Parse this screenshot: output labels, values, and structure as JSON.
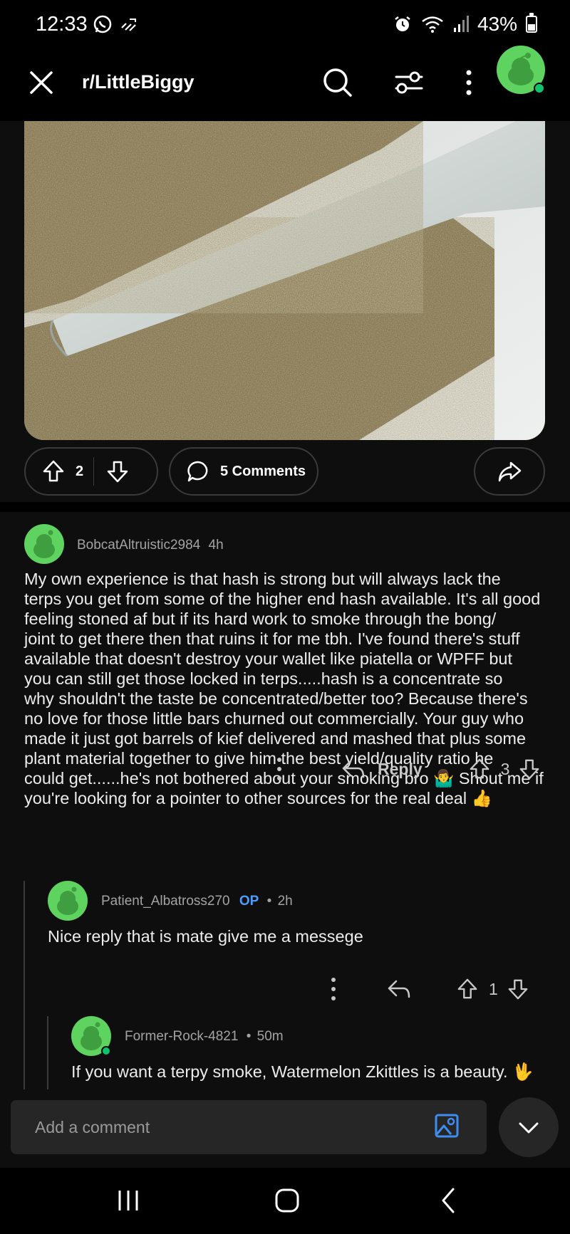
{
  "status_bar": {
    "time": "12:33",
    "battery_percent": "43%",
    "battery_level": 0.43,
    "icons": [
      "whatsapp-icon",
      "missed-call-icon",
      "alarm-icon",
      "wifi-icon",
      "signal-icon",
      "battery-icon"
    ]
  },
  "header": {
    "title": "r/LittleBiggy",
    "icons": [
      "close-icon",
      "search-icon",
      "filter-icon",
      "more-icon",
      "avatar"
    ]
  },
  "post": {
    "upvotes": "2",
    "comments_label": "5 Comments",
    "icons": [
      "upvote-icon",
      "downvote-icon",
      "comment-icon",
      "share-icon"
    ]
  },
  "comments": [
    {
      "username": "BobcatAltruistic2984",
      "time": "4h",
      "body_lines": [
        "My own experience is that hash is strong but will always lack the",
        "terps you get from some of the higher end hash available. It's all good",
        "feeling stoned af but if its hard work to smoke through the bong/",
        "joint to get there then that ruins it for me tbh. I've found there's stuff",
        "available that doesn't destroy your wallet like piatella or WPFF but",
        "you can still get those locked in terps.....hash is a concentrate so",
        "why shouldn't the taste be concentrated/better too? Because there's",
        "no love for those little bars churned out commercially. Your guy who",
        "made it just got barrels of kief delivered and mashed that plus some",
        "plant material together to give him the best yield/quality ratio he",
        "could get......he's not bothered about your smoking bro 🤷‍♂️ Shout me if",
        "you're looking for a pointer to other sources for the real deal 👍"
      ],
      "reply_label": "Reply",
      "votes": "3"
    },
    {
      "username": "Patient_Albatross270",
      "op_badge": "OP",
      "separator": "•",
      "time": "2h",
      "body": "Nice reply that is mate give me a messege",
      "votes": "1"
    },
    {
      "username": "Former-Rock-4821",
      "separator": "•",
      "time": "50m",
      "body": "If you want a terpy smoke, Watermelon Zkittles is a beauty. 🖖"
    }
  ],
  "composer": {
    "placeholder": "Add a comment"
  },
  "colors": {
    "background": "#0e0e0e",
    "avatar_green": "#5fd35f",
    "op_blue": "#4a9eff",
    "online_green": "#11c26d"
  }
}
